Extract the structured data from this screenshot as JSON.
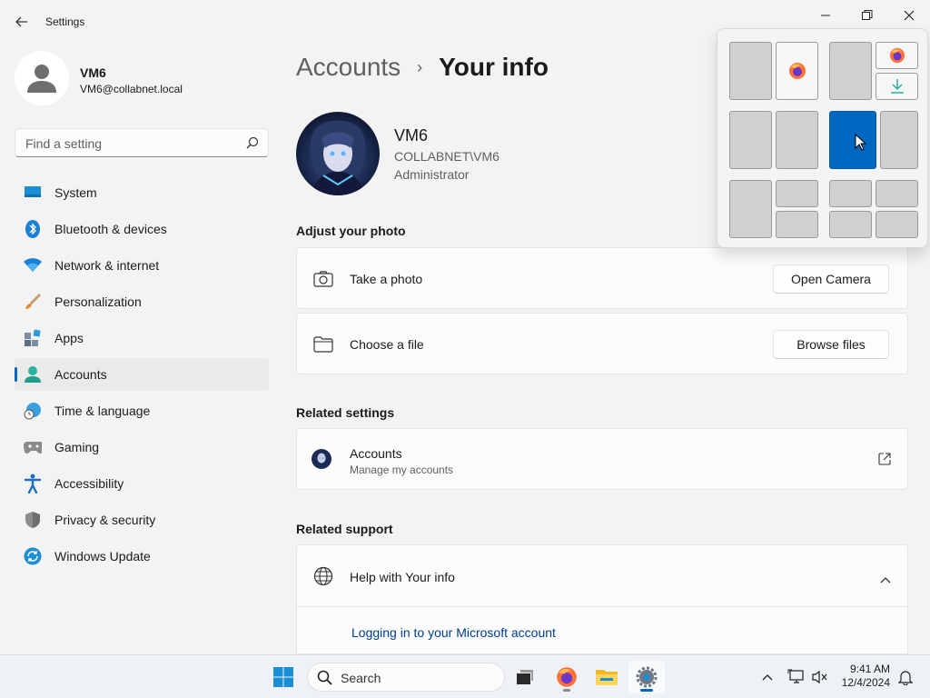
{
  "window": {
    "title": "Settings",
    "controls": [
      "minimize",
      "restore",
      "close"
    ]
  },
  "profile": {
    "name": "VM6",
    "email": "VM6@collabnet.local"
  },
  "search": {
    "placeholder": "Find a setting"
  },
  "sidebar": {
    "items": [
      {
        "label": "System",
        "icon": "system-icon"
      },
      {
        "label": "Bluetooth & devices",
        "icon": "bluetooth-icon"
      },
      {
        "label": "Network & internet",
        "icon": "wifi-icon"
      },
      {
        "label": "Personalization",
        "icon": "brush-icon"
      },
      {
        "label": "Apps",
        "icon": "apps-icon"
      },
      {
        "label": "Accounts",
        "icon": "accounts-icon",
        "selected": true
      },
      {
        "label": "Time & language",
        "icon": "globe-clock-icon"
      },
      {
        "label": "Gaming",
        "icon": "gamepad-icon"
      },
      {
        "label": "Accessibility",
        "icon": "accessibility-icon"
      },
      {
        "label": "Privacy & security",
        "icon": "shield-icon"
      },
      {
        "label": "Windows Update",
        "icon": "update-icon"
      }
    ]
  },
  "main": {
    "breadcrumb": {
      "parent": "Accounts",
      "separator": "›",
      "current": "Your info"
    },
    "user": {
      "name": "VM6",
      "domain": "COLLABNET\\VM6",
      "role": "Administrator"
    },
    "adjust_photo": {
      "title": "Adjust your photo",
      "take_photo": {
        "label": "Take a photo",
        "button": "Open Camera"
      },
      "choose_file": {
        "label": "Choose a file",
        "button": "Browse files"
      }
    },
    "related_settings": {
      "title": "Related settings",
      "accounts": {
        "label": "Accounts",
        "sublabel": "Manage my accounts"
      }
    },
    "related_support": {
      "title": "Related support",
      "help": {
        "label": "Help with Your info"
      },
      "link": "Logging in to your Microsoft account"
    }
  },
  "snap_layouts": {
    "active_zone": "layout-3-left-zone",
    "colors": {
      "active": "#0067c0",
      "zone": "#d0d0d0"
    }
  },
  "taskbar": {
    "search_label": "Search",
    "apps": [
      "start-icon",
      "search-icon",
      "task-view-icon",
      "firefox-icon",
      "file-explorer-icon",
      "settings-icon"
    ],
    "time": "9:41 AM",
    "date": "12/4/2024"
  },
  "colors": {
    "accent": "#0067c0",
    "background": "#f3f3f3",
    "link": "#003e92"
  }
}
